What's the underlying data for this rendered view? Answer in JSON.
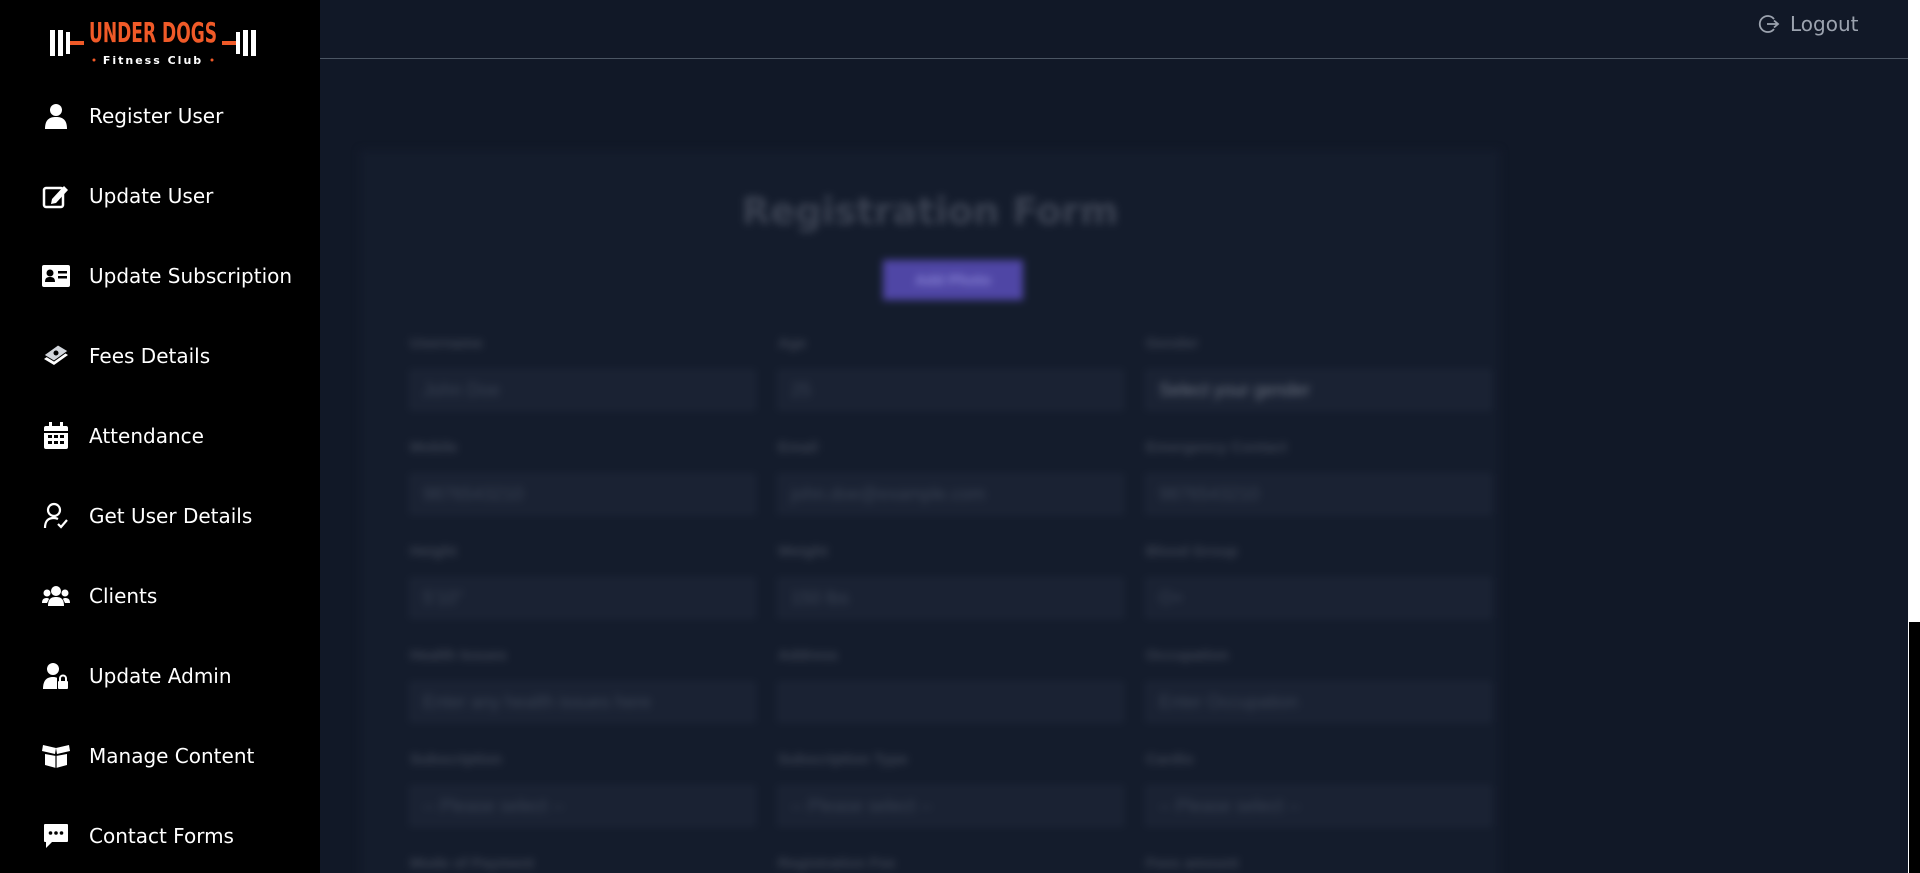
{
  "brand": {
    "logo_text": "UNDER DOGS",
    "logo_subtext": "Fitness Club",
    "accent": "#f05a28"
  },
  "sidebar": {
    "items": [
      {
        "label": "Register User",
        "icon": "user-icon"
      },
      {
        "label": "Update User",
        "icon": "edit-icon"
      },
      {
        "label": "Update Subscription",
        "icon": "id-card-icon"
      },
      {
        "label": "Fees Details",
        "icon": "money-icon"
      },
      {
        "label": "Attendance",
        "icon": "calendar-icon"
      },
      {
        "label": "Get User Details",
        "icon": "user-check-icon"
      },
      {
        "label": "Clients",
        "icon": "users-icon"
      },
      {
        "label": "Update Admin",
        "icon": "user-lock-icon"
      },
      {
        "label": "Manage Content",
        "icon": "box-open-icon"
      },
      {
        "label": "Contact Forms",
        "icon": "comment-dots-icon"
      }
    ]
  },
  "header": {
    "logout_label": "Logout"
  },
  "form": {
    "title": "Registration Form",
    "add_photo_label": "Add Photo",
    "fields": [
      {
        "label": "Username",
        "placeholder": "John Doe"
      },
      {
        "label": "Age",
        "placeholder": "25"
      },
      {
        "label": "Gender",
        "placeholder": "Select your gender"
      },
      {
        "label": "Mobile",
        "placeholder": "9876543210"
      },
      {
        "label": "Email",
        "placeholder": "john.doe@example.com"
      },
      {
        "label": "Emergency Contact",
        "placeholder": "9876543210"
      },
      {
        "label": "Height",
        "placeholder": "5'10\""
      },
      {
        "label": "Weight",
        "placeholder": "150 lbs"
      },
      {
        "label": "Blood Group",
        "placeholder": "O+"
      },
      {
        "label": "Health Issues",
        "placeholder": "Enter any health issues here"
      },
      {
        "label": "Address",
        "placeholder": ""
      },
      {
        "label": "Occupation",
        "placeholder": "Enter Occupation"
      },
      {
        "label": "Subscription",
        "placeholder": "-- Please select --"
      },
      {
        "label": "Subscription Type",
        "placeholder": "-- Please select --"
      },
      {
        "label": "Cardio",
        "placeholder": "-- Please select --"
      },
      {
        "label": "Mode of Payment",
        "placeholder": ""
      },
      {
        "label": "Registration Fee",
        "placeholder": ""
      },
      {
        "label": "Fees amount",
        "placeholder": ""
      }
    ]
  },
  "colors": {
    "sidebar_bg": "#000000",
    "main_bg": "#111827",
    "button_bg": "#4f46a5"
  }
}
